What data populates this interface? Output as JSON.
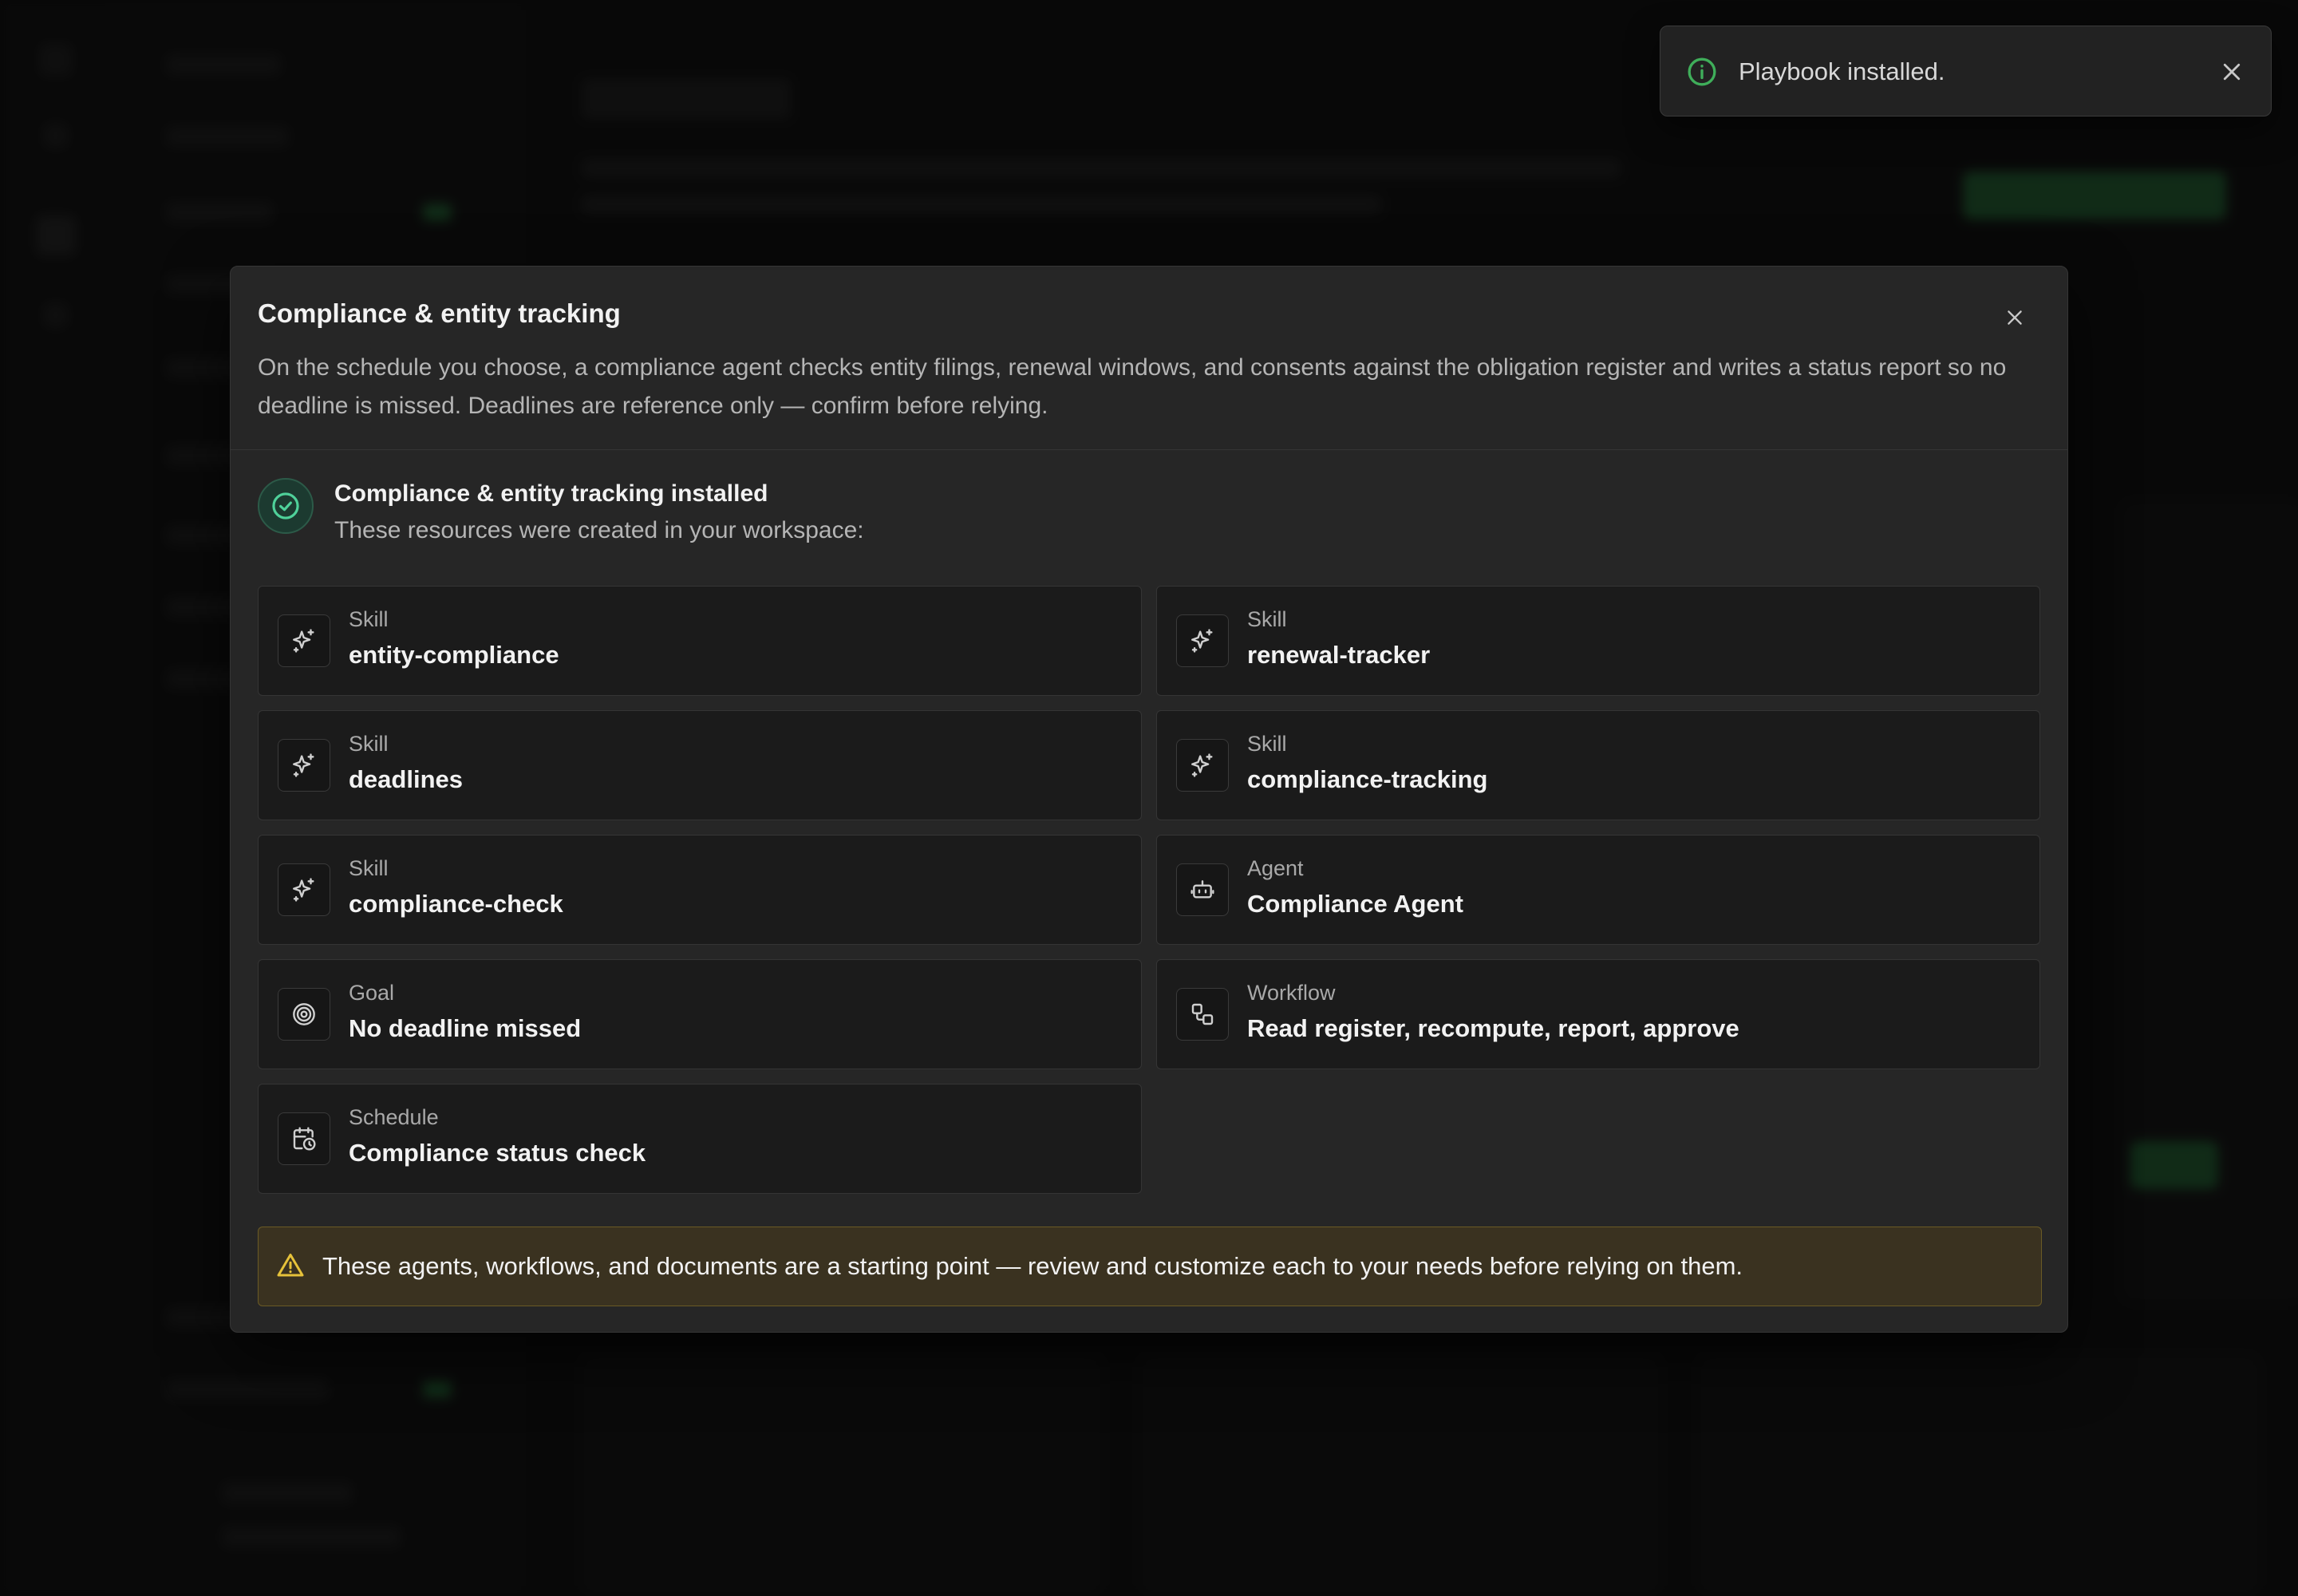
{
  "toast": {
    "message": "Playbook installed.",
    "icon": "info-icon",
    "close_icon": "close-icon",
    "accent": "#3fae5a"
  },
  "modal": {
    "title": "Compliance & entity tracking",
    "description": "On the schedule you choose, a compliance agent checks entity filings, renewal windows, and consents against the obligation register and writes a status report so no deadline is missed. Deadlines are reference only — confirm before relying.",
    "close_icon": "close-icon",
    "success": {
      "title": "Compliance & entity tracking installed",
      "subtitle": "These resources were created in your workspace:",
      "icon": "check-circle-icon",
      "accent": "#4fd19a"
    },
    "resources": [
      {
        "type": "Skill",
        "name": "entity-compliance",
        "icon": "sparkles-icon"
      },
      {
        "type": "Skill",
        "name": "renewal-tracker",
        "icon": "sparkles-icon"
      },
      {
        "type": "Skill",
        "name": "deadlines",
        "icon": "sparkles-icon"
      },
      {
        "type": "Skill",
        "name": "compliance-tracking",
        "icon": "sparkles-icon"
      },
      {
        "type": "Skill",
        "name": "compliance-check",
        "icon": "sparkles-icon"
      },
      {
        "type": "Agent",
        "name": "Compliance Agent",
        "icon": "bot-icon"
      },
      {
        "type": "Goal",
        "name": "No deadline missed",
        "icon": "target-icon"
      },
      {
        "type": "Workflow",
        "name": "Read register, recompute, report, approve",
        "icon": "workflow-icon"
      },
      {
        "type": "Schedule",
        "name": "Compliance status check",
        "icon": "calendar-clock-icon"
      }
    ],
    "warning": {
      "text": "These agents, workflows, and documents are a starting point — review and customize each to your needs before relying on them.",
      "icon": "warning-triangle-icon",
      "accent": "#e6c23a"
    }
  }
}
